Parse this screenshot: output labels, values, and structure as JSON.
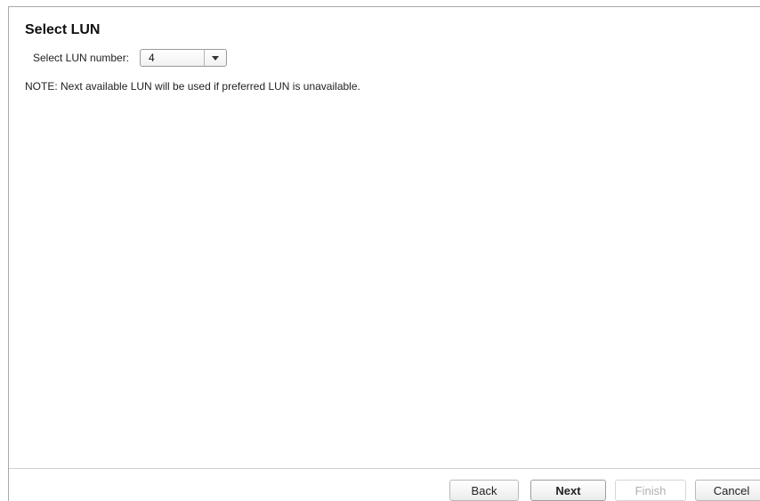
{
  "page": {
    "title": "Select LUN"
  },
  "lun": {
    "label": "Select LUN number:",
    "selected_value": "4",
    "dropdown_icon": "chevron-down-icon"
  },
  "note": {
    "text": "NOTE: Next available LUN will be used if preferred LUN is unavailable."
  },
  "footer": {
    "back_label": "Back",
    "next_label": "Next",
    "finish_label": "Finish",
    "cancel_label": "Cancel",
    "finish_enabled": false
  },
  "colors": {
    "border": "#a8a8a8",
    "disabled_text": "#b0b0b0"
  }
}
